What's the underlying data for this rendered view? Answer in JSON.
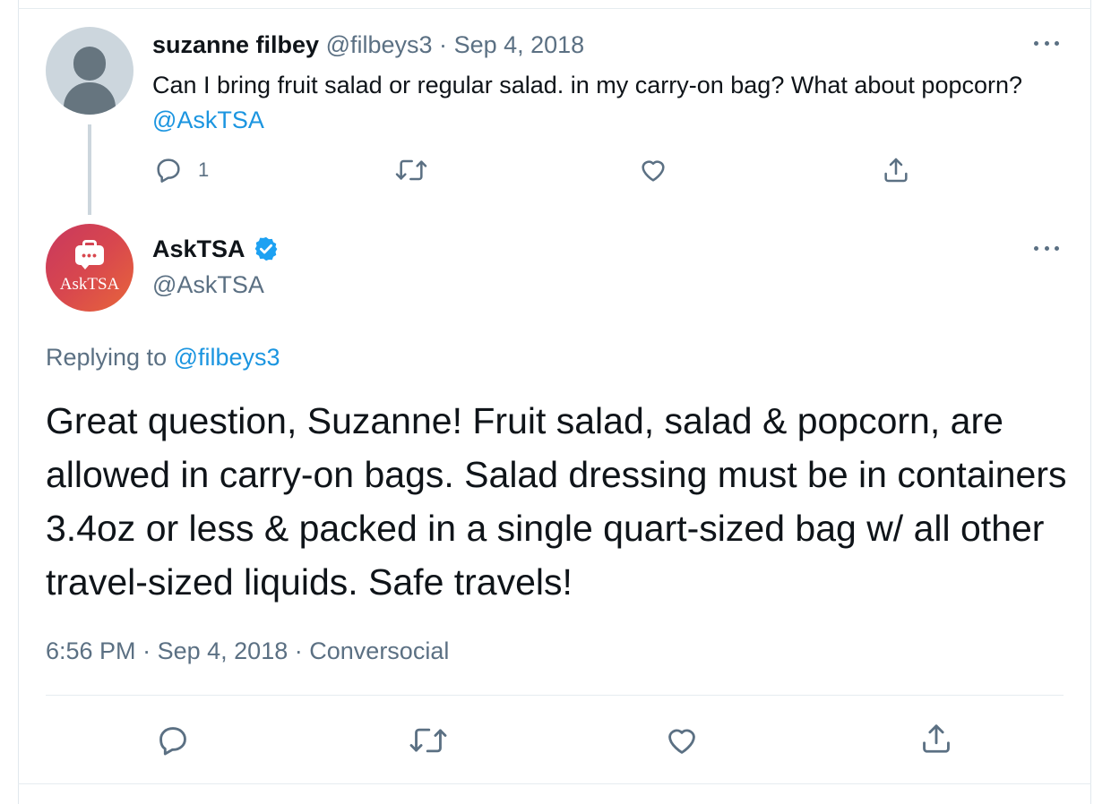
{
  "colors": {
    "text": "#0f1419",
    "muted": "#5b7083",
    "link": "#1b95e0",
    "verified": "#1da1f2",
    "border": "#e6ecf0"
  },
  "reply_tweet": {
    "author_name": "suzanne filbey",
    "handle": "@filbeys3",
    "separator": "·",
    "date": "Sep 4, 2018",
    "text": "Can I bring fruit salad or regular salad. in my carry-on bag? What about popcorn?",
    "mention": "@AskTSA",
    "reply_count": "1",
    "icons": [
      "more-icon",
      "reply-icon",
      "retweet-icon",
      "like-icon",
      "share-icon"
    ]
  },
  "main_tweet": {
    "author_name": "AskTSA",
    "avatar_text": "AskTSA",
    "handle": "@AskTSA",
    "verified": true,
    "replying_prefix": "Replying to",
    "replying_to": "@filbeys3",
    "text": "Great question, Suzanne! Fruit salad, salad & popcorn, are allowed in carry-on bags. Salad dressing must be in containers 3.4oz or less & packed in a single quart-sized bag w/ all other travel-sized liquids. Safe travels!",
    "time": "6:56 PM",
    "separator": "·",
    "date": "Sep 4, 2018",
    "source": "Conversocial",
    "icons": [
      "more-icon",
      "verified-badge-icon",
      "reply-icon",
      "retweet-icon",
      "like-icon",
      "share-icon"
    ]
  }
}
